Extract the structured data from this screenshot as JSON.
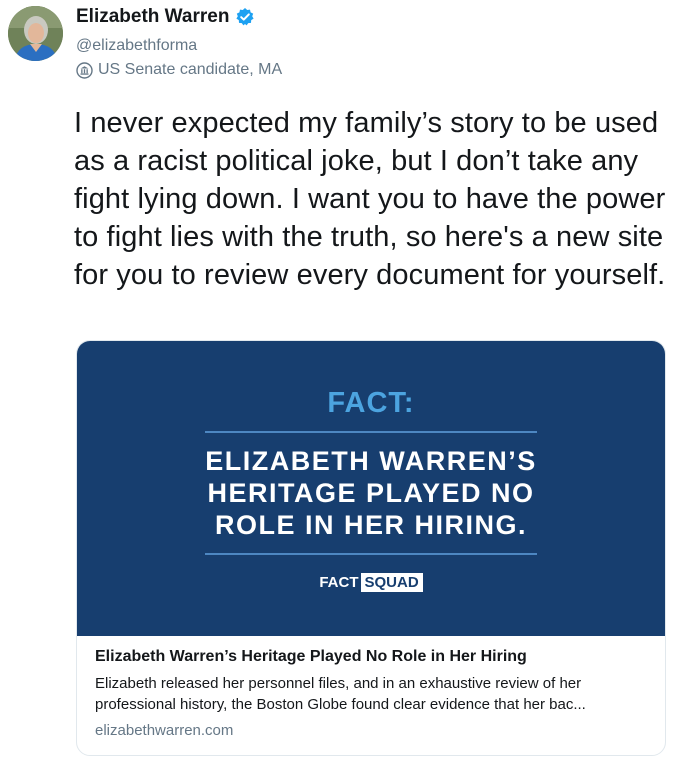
{
  "author": {
    "display_name": "Elizabeth Warren",
    "handle": "@elizabethforma",
    "label": "US Senate candidate, MA",
    "verified_icon": "verified-badge",
    "label_icon": "government-building-icon"
  },
  "tweet": {
    "text": "I never expected my family’s story to be used as a racist political joke, but I don’t take any fight lying down. I want you to have the power to fight lies with the truth, so here's a new site for you to review every document for yourself."
  },
  "card": {
    "image": {
      "heading": "FACT:",
      "body": "ELIZABETH WARREN’S\nHERITAGE PLAYED NO\nROLE IN HER HIRING.",
      "logo_left": "FACT",
      "logo_right": "SQUAD"
    },
    "title": "Elizabeth Warren’s Heritage Played No Role in Her Hiring",
    "description": "Elizabeth released her personnel files, and in an exhaustive review of her\nprofessional history, the Boston Globe found clear evidence that her bac...",
    "domain": "elizabethwarren.com"
  },
  "colors": {
    "card_bg": "#173e6f",
    "fact_blue": "#4ca4e0",
    "verified_blue": "#1da1f2",
    "muted_text": "#657786"
  }
}
